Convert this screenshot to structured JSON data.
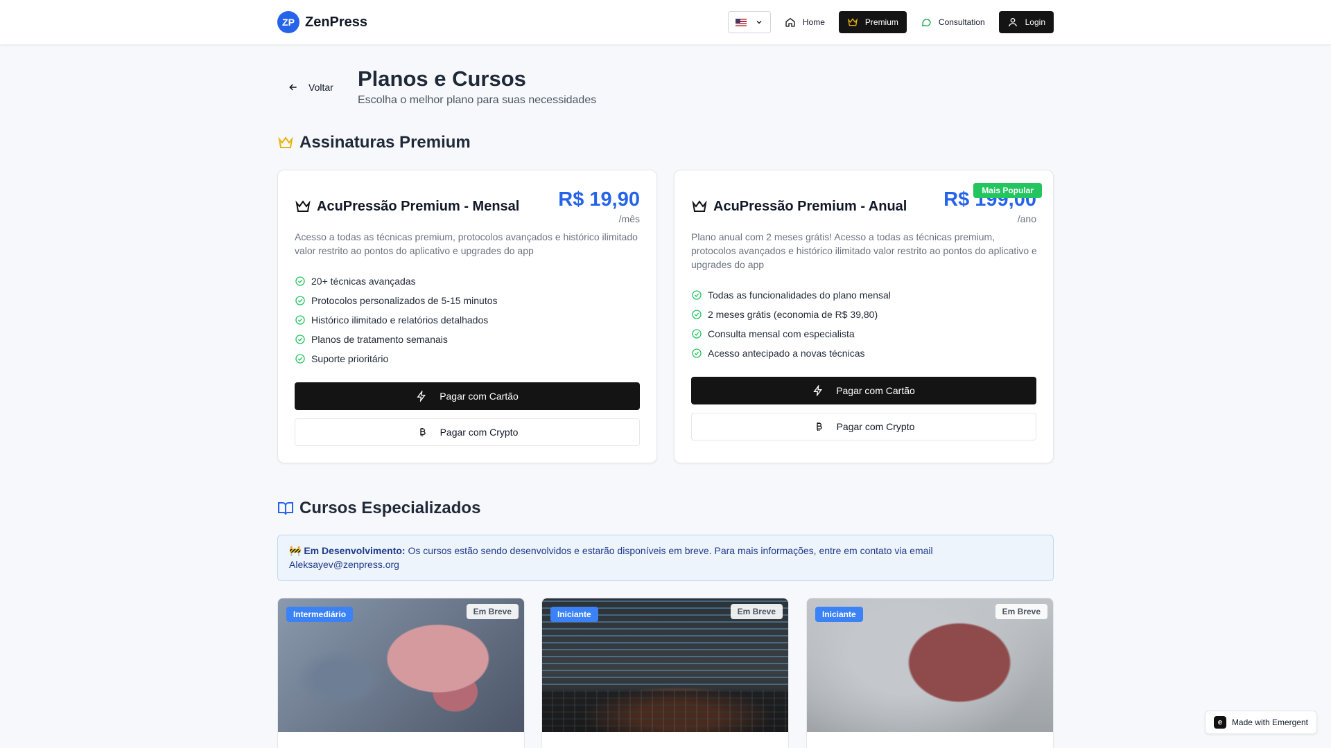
{
  "header": {
    "logo_text": "ZP",
    "brand": "ZenPress",
    "nav": {
      "home": "Home",
      "premium": "Premium",
      "consultation": "Consultation",
      "login": "Login"
    }
  },
  "page": {
    "back": "Voltar",
    "title": "Planos e Cursos",
    "subtitle": "Escolha o melhor plano para suas necessidades"
  },
  "premium_section": {
    "title": "Assinaturas Premium",
    "plans": [
      {
        "name": "AcuPressão Premium - Mensal",
        "price": "R$ 19,90",
        "period": "/mês",
        "description": "Acesso a todas as técnicas premium, protocolos avançados e histórico ilimitado valor restrito ao pontos do aplicativo e upgrades do app",
        "features": [
          "20+ técnicas avançadas",
          "Protocolos personalizados de 5-15 minutos",
          "Histórico ilimitado e relatórios detalhados",
          "Planos de tratamento semanais",
          "Suporte prioritário"
        ],
        "pay_card": "Pagar com Cartão",
        "pay_crypto": "Pagar com Crypto"
      },
      {
        "name": "AcuPressão Premium - Anual",
        "price": "R$ 199,00",
        "period": "/ano",
        "badge": "Mais Popular",
        "description": "Plano anual com 2 meses grátis! Acesso a todas as técnicas premium, protocolos avançados e histórico ilimitado valor restrito ao pontos do aplicativo e upgrades do app",
        "features": [
          "Todas as funcionalidades do plano mensal",
          "2 meses grátis (economia de R$ 39,80)",
          "Consulta mensal com especialista",
          "Acesso antecipado a novas técnicas"
        ],
        "pay_card": "Pagar com Cartão",
        "pay_crypto": "Pagar com Crypto"
      }
    ]
  },
  "courses_section": {
    "title": "Cursos Especializados",
    "notice_icon": "🚧",
    "notice_strong": "Em Desenvolvimento:",
    "notice_text": " Os cursos estão sendo desenvolvidos e estarão disponíveis em breve. Para mais informações, entre em contato via email Aleksayev@zenpress.org",
    "courses": [
      {
        "level": "Intermediário",
        "status": "Em Breve",
        "image": "brain-model"
      },
      {
        "level": "Iniciante",
        "status": "Em Breve",
        "image": "code-screen"
      },
      {
        "level": "Iniciante",
        "status": "Em Breve",
        "image": "brain-model"
      }
    ]
  },
  "footer_badge": "Made with Emergent",
  "colors": {
    "accent": "#2563eb",
    "success": "#22c55e",
    "dark": "#141414"
  }
}
